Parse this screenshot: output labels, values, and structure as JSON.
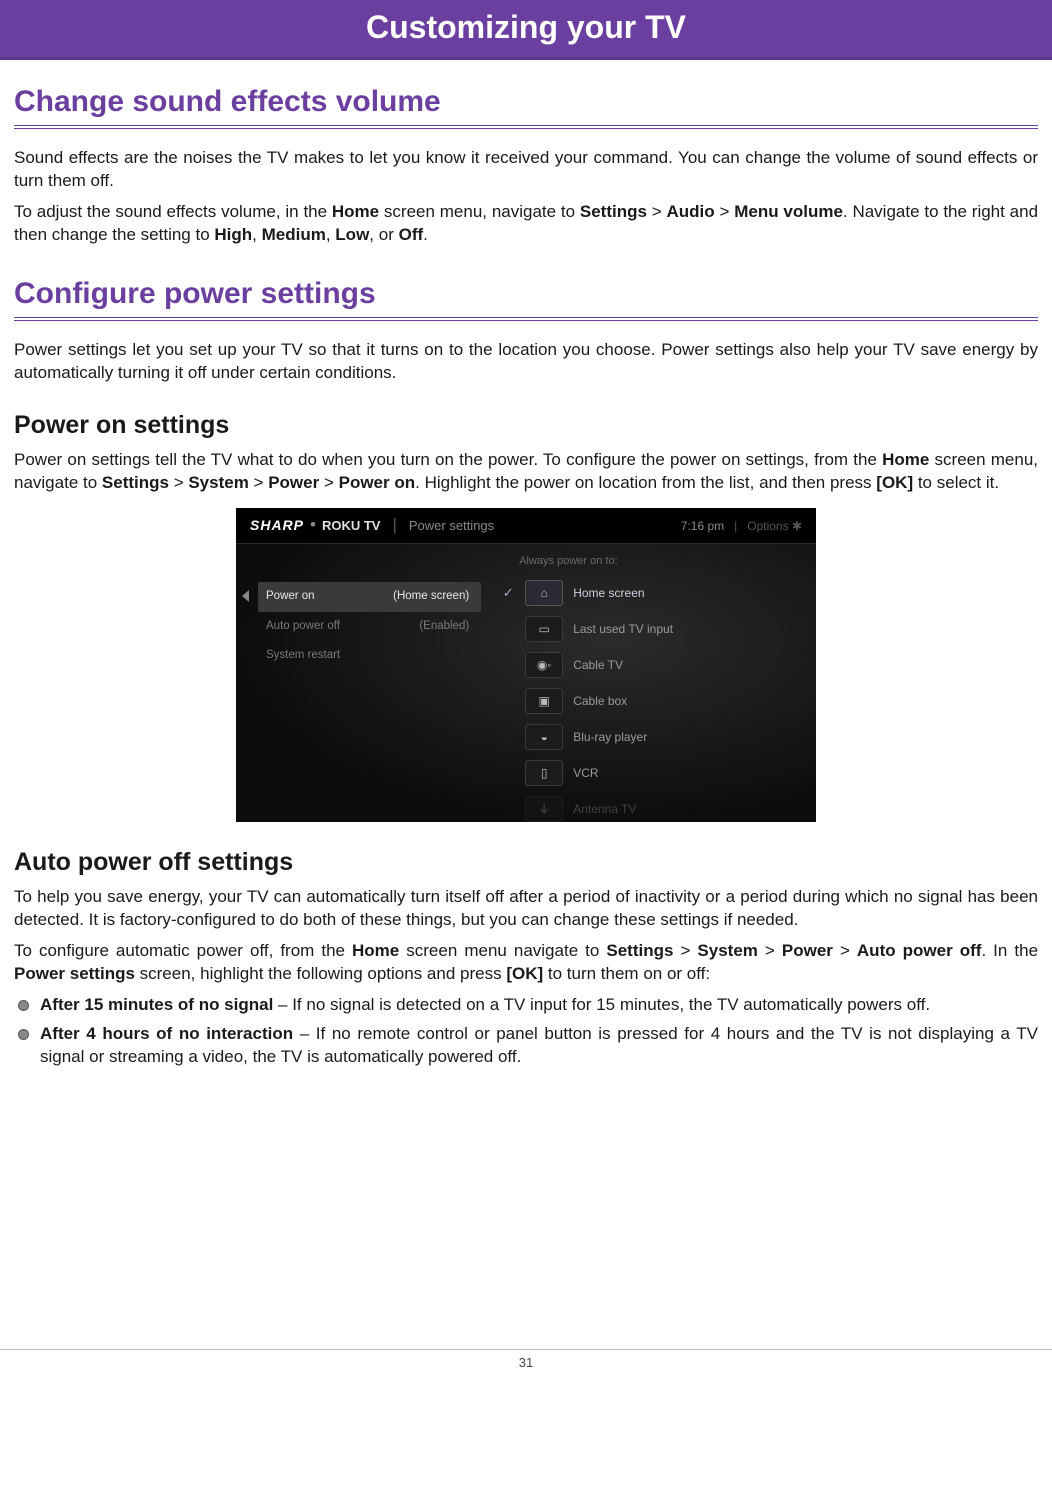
{
  "page_header": "Customizing your TV",
  "section1": {
    "title": "Change sound effects volume",
    "para1": "Sound effects are the noises the TV makes to let you know it received your command. You can change the volume of sound effects or turn them off.",
    "para2_parts": [
      "To adjust the sound effects volume, in the ",
      "Home",
      " screen menu, navigate to ",
      "Settings",
      " > ",
      "Audio",
      " > ",
      "Menu volume",
      ". Navigate to the right and then change the setting to ",
      "High",
      ", ",
      "Medium",
      ", ",
      "Low",
      ", or ",
      "Off",
      "."
    ]
  },
  "section2": {
    "title": "Configure power settings",
    "intro": "Power settings let you set up your TV so that it turns on to the location you choose. Power settings also help your TV save energy by automatically turning it off under certain conditions.",
    "sub1": {
      "title": "Power on settings",
      "para_parts": [
        "Power on settings tell the TV what to do when you turn on the power. To configure the power on settings, from the ",
        "Home",
        " screen menu, navigate to ",
        "Settings",
        " > ",
        "System",
        " > ",
        "Power",
        " > ",
        "Power on",
        ". Highlight the power on location from the list, and then press ",
        "[OK]",
        " to select it."
      ]
    },
    "screenshot": {
      "brand1": "SHARP",
      "dot": "•",
      "brand2": "ROKU TV",
      "sep": "|",
      "screen_name": "Power settings",
      "time": "7:16  pm",
      "options_label": "Options ✱",
      "left_menu": [
        {
          "label": "Power on",
          "value": "(Home screen)",
          "selected": true
        },
        {
          "label": "Auto power off",
          "value": "(Enabled)",
          "selected": false
        },
        {
          "label": "System restart",
          "value": "",
          "selected": false
        }
      ],
      "right_header": "Always power on to:",
      "right_options": [
        {
          "icon": "⌂",
          "label": "Home screen",
          "checked": true,
          "highlight": true
        },
        {
          "icon": "▭",
          "label": "Last used TV input",
          "checked": false
        },
        {
          "icon": "◉◦",
          "label": "Cable TV",
          "checked": false
        },
        {
          "icon": "▣",
          "label": "Cable box",
          "checked": false
        },
        {
          "icon": "◒",
          "label": "Blu-ray player",
          "checked": false
        },
        {
          "icon": "▯",
          "label": "VCR",
          "checked": false
        },
        {
          "icon": "⏚",
          "label": "Antenna TV",
          "checked": false
        }
      ]
    },
    "sub2": {
      "title": "Auto power off settings",
      "para1": "To help you save energy, your TV can automatically turn itself off after a period of inactivity or a period during which no signal has been detected. It is factory-configured to do both of these things, but you can change these settings if needed.",
      "para2_parts": [
        "To configure automatic power off, from the ",
        "Home",
        " screen menu navigate to ",
        "Settings",
        " > ",
        "System",
        " > ",
        "Power",
        " > ",
        "Auto power off",
        ". In the ",
        "Power settings",
        " screen, highlight the following options and press ",
        "[OK]",
        " to turn them on or off:"
      ],
      "bullets": [
        {
          "lead": "After 15 minutes of no signal",
          "rest": " – If no signal is detected on a TV input for 15 minutes, the TV automatically powers off."
        },
        {
          "lead": "After 4 hours of no interaction",
          "rest": " – If no remote control or panel button is pressed for 4 hours and the TV is not displaying a TV signal or streaming a video, the TV is automatically powered off."
        }
      ]
    }
  },
  "page_number": "31"
}
